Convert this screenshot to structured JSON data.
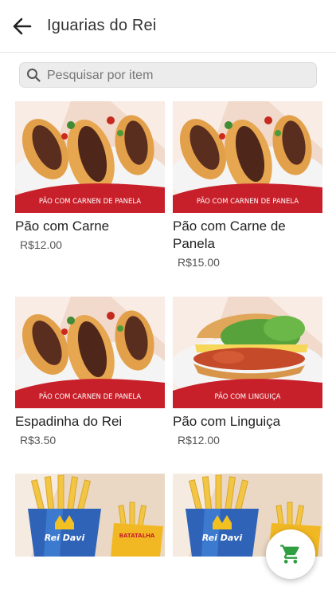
{
  "header": {
    "title": "Iguarias do Rei",
    "back_icon": "arrow-left-icon"
  },
  "search": {
    "placeholder": "Pesquisar por item",
    "icon": "search-icon"
  },
  "items": [
    {
      "name": "Pão com Carne",
      "price": "R$12.00",
      "banner": "PÃO COM CARNEN DE PANELA"
    },
    {
      "name": "Pão com Carne de Panela",
      "price": "R$15.00",
      "banner": "PÃO COM CARNEN DE PANELA"
    },
    {
      "name": "Espadinha do Rei",
      "price": "R$3.50",
      "banner": "PÃO COM CARNEN DE PANELA"
    },
    {
      "name": "Pão com Linguiça",
      "price": "R$12.00",
      "banner": "PÃO COM LINGUIÇA"
    }
  ],
  "fries_images": [
    {
      "brand": "Rei Davi",
      "label": "BATATALHA"
    },
    {
      "brand": "Rei Davi",
      "label": "BATATALHA"
    }
  ],
  "cart_button": {
    "icon": "cart-icon",
    "color": "#2e9e41"
  },
  "colors": {
    "banner_red": "#c8202a",
    "cart_green": "#2e9e41"
  }
}
